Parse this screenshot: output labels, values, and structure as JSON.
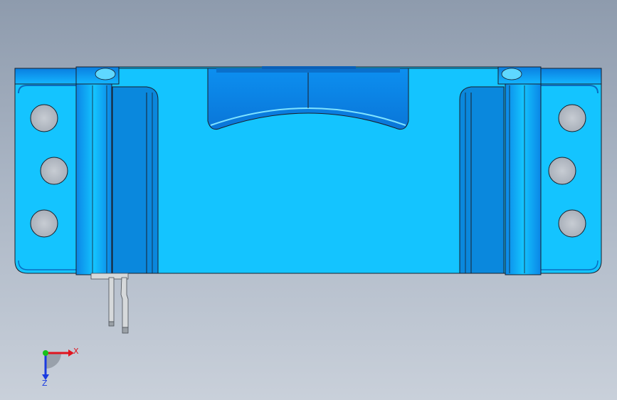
{
  "viewport": {
    "background_top": "#8e9bad",
    "background_bottom": "#c9d0da"
  },
  "model": {
    "face_color": "#14c4ff",
    "dark_face_color": "#0a88dd",
    "mid_face_color": "#0f9fef",
    "edge_color": "#1a1f2a",
    "hole_color": "#bfc5cd",
    "pin_color": "#d6d9db",
    "holes_per_side": 3
  },
  "triad": {
    "x_label": "X",
    "z_label": "Z",
    "x_color": "#e0141e",
    "y_color": "#17c21a",
    "z_color": "#1a3be0"
  }
}
